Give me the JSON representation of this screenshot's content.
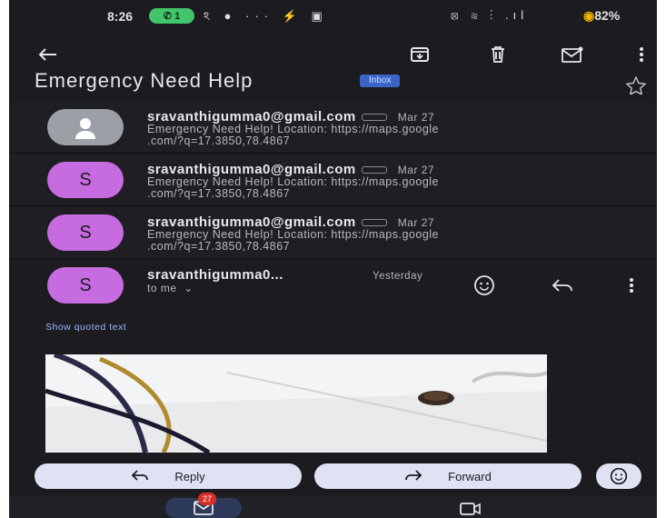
{
  "status_bar": {
    "time": "8:26",
    "pill_text": "1",
    "left_icons": "ঽ ● ··· ⚡ ▣",
    "right_icons": "⦻ ≋ ⋮ .ıl",
    "battery": "82%"
  },
  "toolbar": {
    "back_icon": "arrow-left-icon",
    "archive_icon": "archive-icon",
    "delete_icon": "trash-icon",
    "mark_unread_icon": "mail-unread-icon",
    "more_icon": "more-vertical-icon"
  },
  "email": {
    "subject": "Emergency Need Help",
    "label": "Inbox"
  },
  "threads": [
    {
      "avatar": "",
      "sender": "sravanthigumma0@gmail.com",
      "date": "Mar 27",
      "snippet_1": "Emergency Need Help! Location: https://maps.google",
      "snippet_2": ".com/?q=17.3850,78.4867"
    },
    {
      "avatar": "S",
      "sender": "sravanthigumma0@gmail.com",
      "date": "Mar 27",
      "snippet_1": "Emergency Need Help! Location: https://maps.google",
      "snippet_2": ".com/?q=17.3850,78.4867"
    },
    {
      "avatar": "S",
      "sender": "sravanthigumma0@gmail.com",
      "date": "Mar 27",
      "snippet_1": "Emergency Need Help! Location: https://maps.google",
      "snippet_2": ".com/?q=17.3850,78.4867"
    }
  ],
  "open_message": {
    "avatar": "S",
    "sender": "sravanthigumma0...",
    "date": "Yesterday",
    "to": "to me",
    "show_quoted": "Show quoted text"
  },
  "actions": {
    "reply": "Reply",
    "forward": "Forward"
  },
  "nav": {
    "mail_badge": "27"
  },
  "colors": {
    "background": "#1b1b20",
    "avatar_purple": "#c66be0",
    "button_bg": "#dfe2f3",
    "label_chip": "#3a64c6",
    "badge": "#d93025"
  }
}
